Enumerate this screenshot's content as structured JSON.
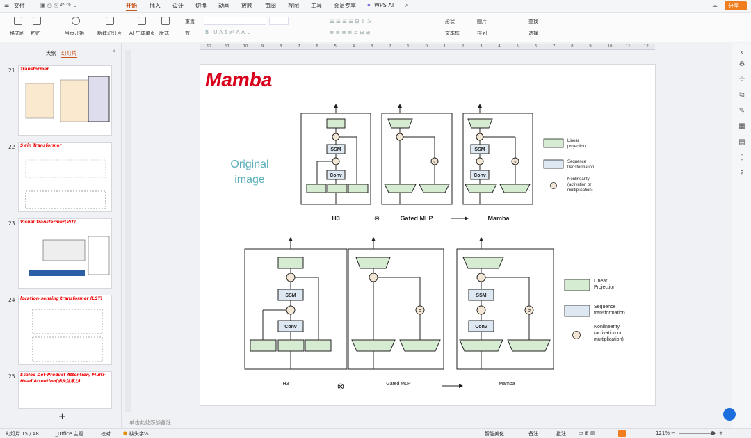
{
  "titlebar": {
    "file_menu": "文件",
    "tabs": [
      "开始",
      "插入",
      "设计",
      "切换",
      "动画",
      "放映",
      "审阅",
      "视图",
      "工具",
      "会员专享"
    ],
    "active_tab": "开始",
    "wps_ai": "WPS AI",
    "share": "分享"
  },
  "ribbon": {
    "format_painter": "格式刷",
    "paste": "粘贴",
    "from_current": "当页开始",
    "new_slide": "新建幻灯片",
    "ai_single": "AI 生成单页",
    "layout": "版式",
    "section": "节",
    "reset": "重置",
    "shape": "形状",
    "picture": "图片",
    "textbox": "文本框",
    "arrange": "排列",
    "find": "查找",
    "select": "选择"
  },
  "leftpane": {
    "tab_outline": "大纲",
    "tab_slides": "幻灯片",
    "add_label": "+",
    "thumbs": [
      {
        "num": "21",
        "title": "Transformer"
      },
      {
        "num": "22",
        "title": "Swin Transformer"
      },
      {
        "num": "23",
        "title": "Visual Transformer(ViT)"
      },
      {
        "num": "24",
        "title": "location-sensing transformer (LST)"
      },
      {
        "num": "25",
        "title": "Scaled Dot-Product Attention/ Multi-Head Attention(多头注意力)"
      }
    ]
  },
  "ruler": {
    "h_ticks": [
      "12",
      "11",
      "10",
      "9",
      "8",
      "7",
      "6",
      "5",
      "4",
      "3",
      "2",
      "1",
      "0",
      "1",
      "2",
      "3",
      "4",
      "5",
      "6",
      "7",
      "8",
      "9",
      "10",
      "11",
      "12"
    ]
  },
  "slide": {
    "title": "Mamba",
    "original_label_1": "Original",
    "original_label_2": "image",
    "top": {
      "h3": "H3",
      "gated": "Gated MLP",
      "mamba": "Mamba",
      "ssm": "SSM",
      "conv": "Conv",
      "sigma": "σ",
      "legend_linear_1": "Linear",
      "legend_linear_2": "projection",
      "legend_seq_1": "Sequence",
      "legend_seq_2": "transformation",
      "legend_nl_1": "Nonlinearity",
      "legend_nl_2": "(activation or",
      "legend_nl_3": "multiplication)"
    },
    "bottom": {
      "h3": "H3",
      "gated": "Gated MLP",
      "mamba": "Mamba",
      "legend_linear_1": "Linear",
      "legend_linear_2": "Projection",
      "legend_seq_1": "Sequence",
      "legend_seq_2": "transformation",
      "legend_nl_1": "Nonlinearity",
      "legend_nl_2": "(activation or",
      "legend_nl_3": "multiplication)"
    }
  },
  "notes_placeholder": "单击此处添加备注",
  "status": {
    "slide_count": "幻灯片 15 / 48",
    "theme": "1_Office 主题",
    "proof": "校对",
    "missing_font": "缺失字体",
    "beautify": "智能美化",
    "notes": "备注",
    "comment": "批注",
    "zoom": "121%"
  },
  "colors": {
    "accent": "#d9001b",
    "linear_fill": "#d6ecd2",
    "seq_fill": "#dde8f3",
    "orig_text": "#5ab0b8"
  }
}
